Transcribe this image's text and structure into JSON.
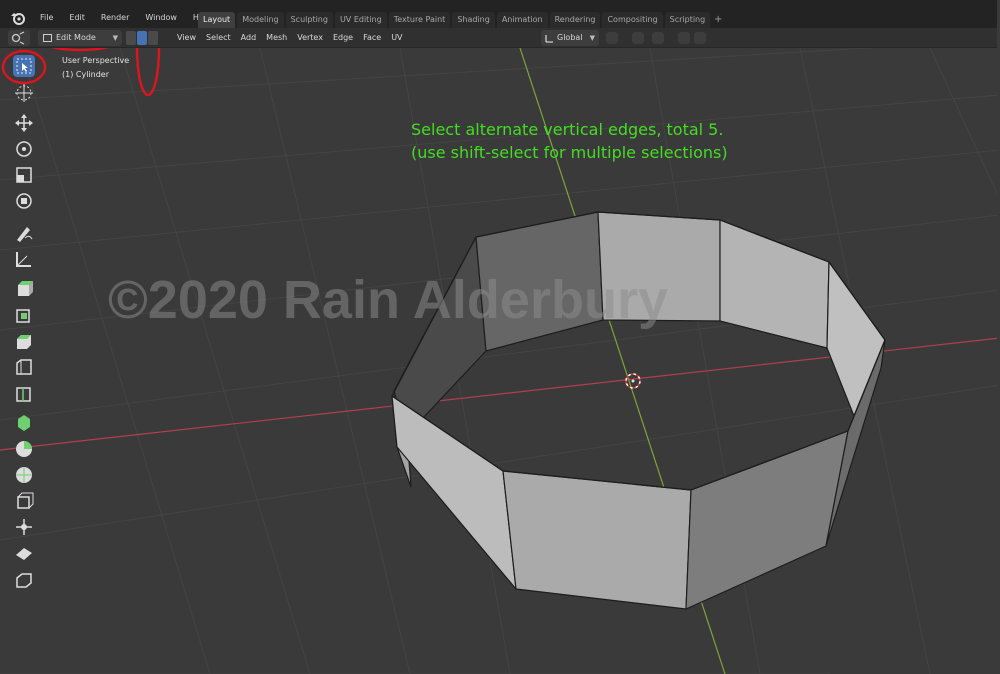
{
  "app": {
    "menus": [
      "File",
      "Edit",
      "Render",
      "Window",
      "Help"
    ],
    "workspace_tabs": [
      "Layout",
      "Modeling",
      "Sculpting",
      "UV Editing",
      "Texture Paint",
      "Shading",
      "Animation",
      "Rendering",
      "Compositing",
      "Scripting"
    ],
    "active_tab": "Layout",
    "add_tab": "+"
  },
  "header": {
    "mode_label": "Edit Mode",
    "menus": [
      "View",
      "Select",
      "Add",
      "Mesh",
      "Vertex",
      "Edge",
      "Face",
      "UV"
    ],
    "orientation_label": "Global"
  },
  "viewport": {
    "view_name": "User Perspective",
    "object_name": "(1) Cylinder",
    "instruction_line1": "Select alternate vertical edges, total 5.",
    "instruction_line2": "(use shift-select for multiple selections)",
    "watermark": "©2020 Rain Alderbury"
  },
  "tools": [
    "select-box",
    "cursor",
    "move",
    "rotate",
    "scale",
    "transform",
    "annotate",
    "measure",
    "add-cube",
    "extrude",
    "inset",
    "bevel",
    "loop-cut",
    "knife",
    "poly-build",
    "spin",
    "smooth",
    "edge-slide",
    "shrink-fatten",
    "shear",
    "rip"
  ],
  "colors": {
    "background": "#3a3a3a",
    "grid": "#444444",
    "x_axis": "#b04050",
    "y_axis": "#7ea33a",
    "instruction": "#44dd22",
    "active_tool": "#4772b3",
    "annotation": "#e0141e"
  }
}
